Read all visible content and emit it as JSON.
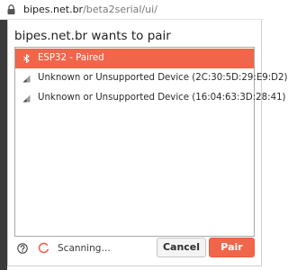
{
  "browser": {
    "url_host": "bipes.net.br",
    "url_path": "/beta2serial/ui/"
  },
  "dialog": {
    "title": "bipes.net.br wants to pair",
    "devices": [
      {
        "label": "ESP32 - Paired",
        "selected": true,
        "icon": "bluetooth-icon"
      },
      {
        "label": "Unknown or Unsupported Device (2C:30:5D:29:E9:D2)",
        "selected": false,
        "icon": "signal-strength-icon"
      },
      {
        "label": "Unknown or Unsupported Device (16:04:63:3D:28:41)",
        "selected": false,
        "icon": "signal-strength-icon"
      }
    ],
    "status": "Scanning…",
    "cancel_label": "Cancel",
    "pair_label": "Pair"
  },
  "colors": {
    "accent": "#f0664a"
  }
}
